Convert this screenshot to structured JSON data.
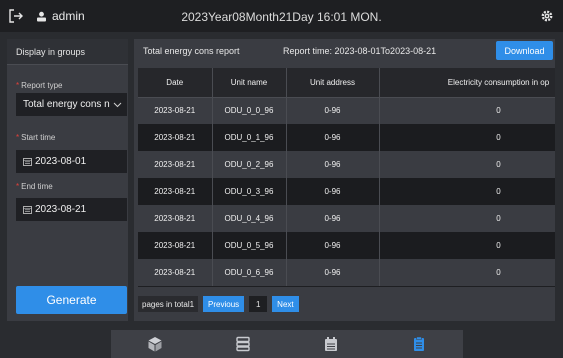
{
  "topbar": {
    "username": "admin",
    "datetime": "2023Year08Month21Day 16:01 MON."
  },
  "sidebar": {
    "title": "Display in groups",
    "report_type_label": "Report type",
    "report_type_value": "Total energy cons n",
    "start_label": "Start time",
    "start_value": "2023-08-01",
    "end_label": "End time",
    "end_value": "2023-08-21",
    "generate_label": "Generate"
  },
  "main": {
    "report_title": "Total energy cons report",
    "report_time": "Report time: 2023-08-01To2023-08-21",
    "download_label": "Download",
    "columns": [
      "Date",
      "Unit name",
      "Unit address",
      "Electricity consumption in op"
    ],
    "rows": [
      [
        "2023-08-21",
        "ODU_0_0_96",
        "0-96",
        "0"
      ],
      [
        "2023-08-21",
        "ODU_0_1_96",
        "0-96",
        "0"
      ],
      [
        "2023-08-21",
        "ODU_0_2_96",
        "0-96",
        "0"
      ],
      [
        "2023-08-21",
        "ODU_0_3_96",
        "0-96",
        "0"
      ],
      [
        "2023-08-21",
        "ODU_0_4_96",
        "0-96",
        "0"
      ],
      [
        "2023-08-21",
        "ODU_0_5_96",
        "0-96",
        "0"
      ],
      [
        "2023-08-21",
        "ODU_0_6_96",
        "0-96",
        "0"
      ]
    ],
    "pager": {
      "total": "pages in total1",
      "previous": "Previous",
      "page": "1",
      "next": "Next"
    }
  },
  "bottom_nav": [
    "cube-icon",
    "list-icon",
    "calendar-icon",
    "report-icon"
  ],
  "colors": {
    "accent": "#2f8ee8",
    "active_nav": "#2f8ee8",
    "required_star": "#e0403a"
  }
}
